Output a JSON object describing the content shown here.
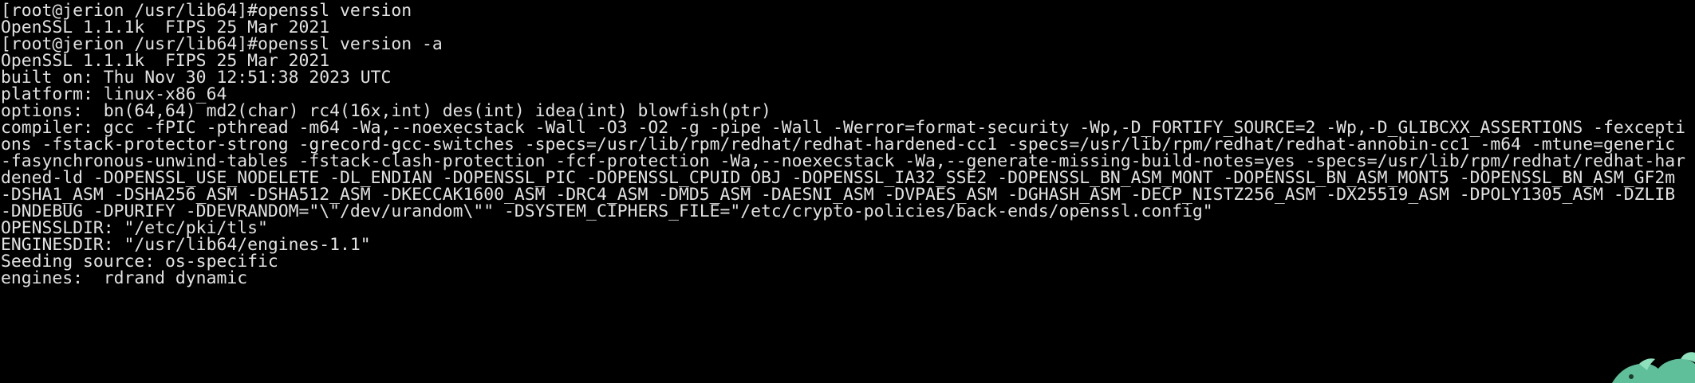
{
  "terminal": {
    "lines": [
      "[root@jerion /usr/lib64]#openssl version",
      "OpenSSL 1.1.1k  FIPS 25 Mar 2021",
      "[root@jerion /usr/lib64]#openssl version -a",
      "OpenSSL 1.1.1k  FIPS 25 Mar 2021",
      "built on: Thu Nov 30 12:51:38 2023 UTC",
      "platform: linux-x86_64",
      "options:  bn(64,64) md2(char) rc4(16x,int) des(int) idea(int) blowfish(ptr)",
      "compiler: gcc -fPIC -pthread -m64 -Wa,--noexecstack -Wall -O3 -O2 -g -pipe -Wall -Werror=format-security -Wp,-D_FORTIFY_SOURCE=2 -Wp,-D_GLIBCXX_ASSERTIONS -fexcepti",
      "ons -fstack-protector-strong -grecord-gcc-switches -specs=/usr/lib/rpm/redhat/redhat-hardened-cc1 -specs=/usr/lib/rpm/redhat/redhat-annobin-cc1 -m64 -mtune=generic",
      "-fasynchronous-unwind-tables -fstack-clash-protection -fcf-protection -Wa,--noexecstack -Wa,--generate-missing-build-notes=yes -specs=/usr/lib/rpm/redhat/redhat-har",
      "dened-ld -DOPENSSL_USE_NODELETE -DL_ENDIAN -DOPENSSL_PIC -DOPENSSL_CPUID_OBJ -DOPENSSL_IA32_SSE2 -DOPENSSL_BN_ASM_MONT -DOPENSSL_BN_ASM_MONT5 -DOPENSSL_BN_ASM_GF2m",
      "-DSHA1_ASM -DSHA256_ASM -DSHA512_ASM -DKECCAK1600_ASM -DRC4_ASM -DMD5_ASM -DAESNI_ASM -DVPAES_ASM -DGHASH_ASM -DECP_NISTZ256_ASM -DX25519_ASM -DPOLY1305_ASM -DZLIB",
      "-DNDEBUG -DPURIFY -DDEVRANDOM=\"\\\"/dev/urandom\\\"\" -DSYSTEM_CIPHERS_FILE=\"/etc/crypto-policies/back-ends/openssl.config\"",
      "OPENSSLDIR: \"/etc/pki/tls\"",
      "ENGINESDIR: \"/usr/lib64/engines-1.1\"",
      "Seeding source: os-specific",
      "engines:  rdrand dynamic"
    ]
  },
  "colors": {
    "background": "#000000",
    "text": "#e2e2e2",
    "mascot": "#5fbf9a"
  },
  "icons": {
    "corner": "mascot-icon"
  }
}
